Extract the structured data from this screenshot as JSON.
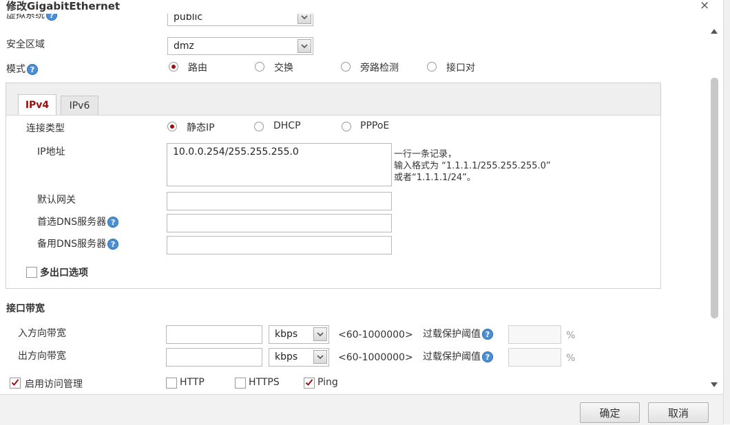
{
  "window": {
    "title": "修改GigabitEthernet",
    "close_glyph": "×"
  },
  "top": {
    "cut_label": "虚拟系统",
    "cut_value": "public",
    "zone_label": "安全区域",
    "zone_value": "dmz",
    "mode_label": "模式",
    "mode_options": [
      "路由",
      "交换",
      "旁路检测",
      "接口对"
    ],
    "mode_selected": "路由"
  },
  "tabs": [
    {
      "label": "IPv4",
      "active": true
    },
    {
      "label": "IPv6",
      "active": false
    }
  ],
  "ipv4": {
    "conn_type_label": "连接类型",
    "conn_options": [
      "静态IP",
      "DHCP",
      "PPPoE"
    ],
    "conn_selected": "静态IP",
    "ip_label": "IP地址",
    "ip_value": "10.0.0.254/255.255.255.0",
    "ip_hint": [
      "一行一条记录，",
      "输入格式为 “1.1.1.1/255.255.255.0”",
      "或者“1.1.1.1/24”。"
    ],
    "gateway_label": "默认网关",
    "gateway_value": "",
    "dns1_label": "首选DNS服务器",
    "dns1_value": "",
    "dns2_label": "备用DNS服务器",
    "dns2_value": "",
    "multi_exit_label": "多出口选项",
    "multi_exit_checked": false
  },
  "bandwidth": {
    "section_label": "接口带宽",
    "rows": [
      {
        "label": "入方向带宽",
        "value": "",
        "unit": "kbps",
        "range": "<60-1000000>",
        "protect_label": "过载保护阈值",
        "protect_value": "",
        "pct": "%"
      },
      {
        "label": "出方向带宽",
        "value": "",
        "unit": "kbps",
        "range": "<60-1000000>",
        "protect_label": "过载保护阈值",
        "protect_value": "",
        "pct": "%"
      }
    ]
  },
  "access": {
    "label": "启用访问管理",
    "checked": true,
    "options": [
      {
        "label": "HTTP",
        "checked": false
      },
      {
        "label": "HTTPS",
        "checked": false
      },
      {
        "label": "Ping",
        "checked": true
      }
    ]
  },
  "footer": {
    "ok_label": "确定",
    "cancel_label": "取消"
  },
  "colors": {
    "accent": "#a10d0d",
    "help": "#4d8fd6"
  }
}
